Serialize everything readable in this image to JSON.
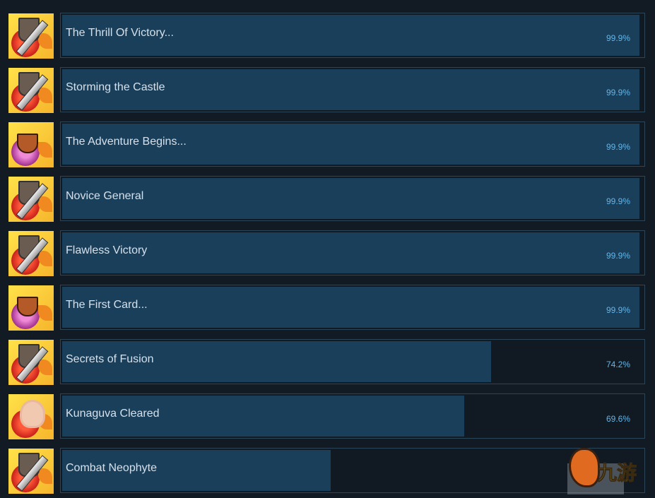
{
  "achievements": [
    {
      "name": "The Thrill Of Victory...",
      "percent": "99.9%",
      "fill": 99.9,
      "icon": "sword-icon"
    },
    {
      "name": "Storming the Castle",
      "percent": "99.9%",
      "fill": 99.9,
      "icon": "sword-icon"
    },
    {
      "name": "The Adventure Begins...",
      "percent": "99.9%",
      "fill": 99.9,
      "icon": "trophy-icon"
    },
    {
      "name": "Novice General",
      "percent": "99.9%",
      "fill": 99.9,
      "icon": "sword-icon"
    },
    {
      "name": "Flawless Victory",
      "percent": "99.9%",
      "fill": 99.9,
      "icon": "sword-icon"
    },
    {
      "name": "The First Card...",
      "percent": "99.9%",
      "fill": 99.9,
      "icon": "trophy-icon"
    },
    {
      "name": "Secrets of Fusion",
      "percent": "74.2%",
      "fill": 74.2,
      "icon": "sword-icon"
    },
    {
      "name": "Kunaguva Cleared",
      "percent": "69.6%",
      "fill": 69.6,
      "icon": "character-icon"
    },
    {
      "name": "Combat Neophyte",
      "percent": "",
      "fill": 46.5,
      "icon": "sword-icon"
    }
  ],
  "watermark": {
    "text": "九游"
  },
  "colors": {
    "background": "#121a23",
    "bar_fill": "#1a3f5a",
    "percent_text": "#62b6ea"
  }
}
